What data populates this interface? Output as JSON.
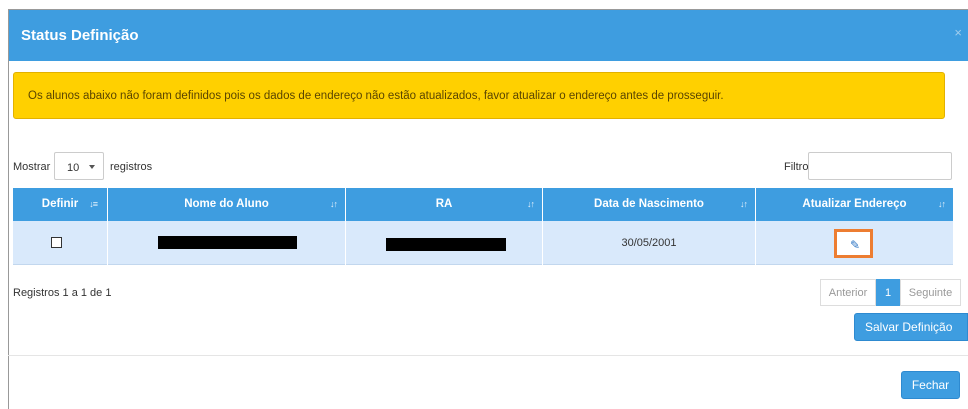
{
  "modal": {
    "title": "Status Definição",
    "close_glyph": "×"
  },
  "alert": {
    "text": "Os alunos abaixo não foram definidos pois os dados de endereço não estão atualizados, favor atualizar o endereço antes de prosseguir.",
    "color": "#ffd000"
  },
  "controls": {
    "length_label": "Mostrar",
    "length_value": "10",
    "length_suffix": "registros",
    "filter_label": "Filtro",
    "filter_value": ""
  },
  "table": {
    "columns": [
      {
        "label": "Definir",
        "sort_icon": "sort-numeric-icon"
      },
      {
        "label": "Nome do Aluno",
        "sort_icon": "sort-icon"
      },
      {
        "label": "RA",
        "sort_icon": "sort-icon"
      },
      {
        "label": "Data de Nascimento",
        "sort_icon": "sort-icon"
      },
      {
        "label": "Atualizar Endereço",
        "sort_icon": "sort-icon"
      }
    ],
    "rows": [
      {
        "definir_checked": false,
        "nome": "[redacted]",
        "ra": "[redacted]",
        "data_nascimento": "30/05/2001",
        "action_icon": "pencil-icon"
      }
    ],
    "header_color": "#3e9de0",
    "row_color": "#d9e9fb"
  },
  "footer_info": "Registros 1 a 1 de 1",
  "pagination": {
    "prev": "Anterior",
    "current": "1",
    "next": "Seguinte"
  },
  "buttons": {
    "save": "Salvar Definição",
    "close": "Fechar"
  },
  "accent_color": "#3e9de0",
  "highlight_color": "#ed7d31"
}
